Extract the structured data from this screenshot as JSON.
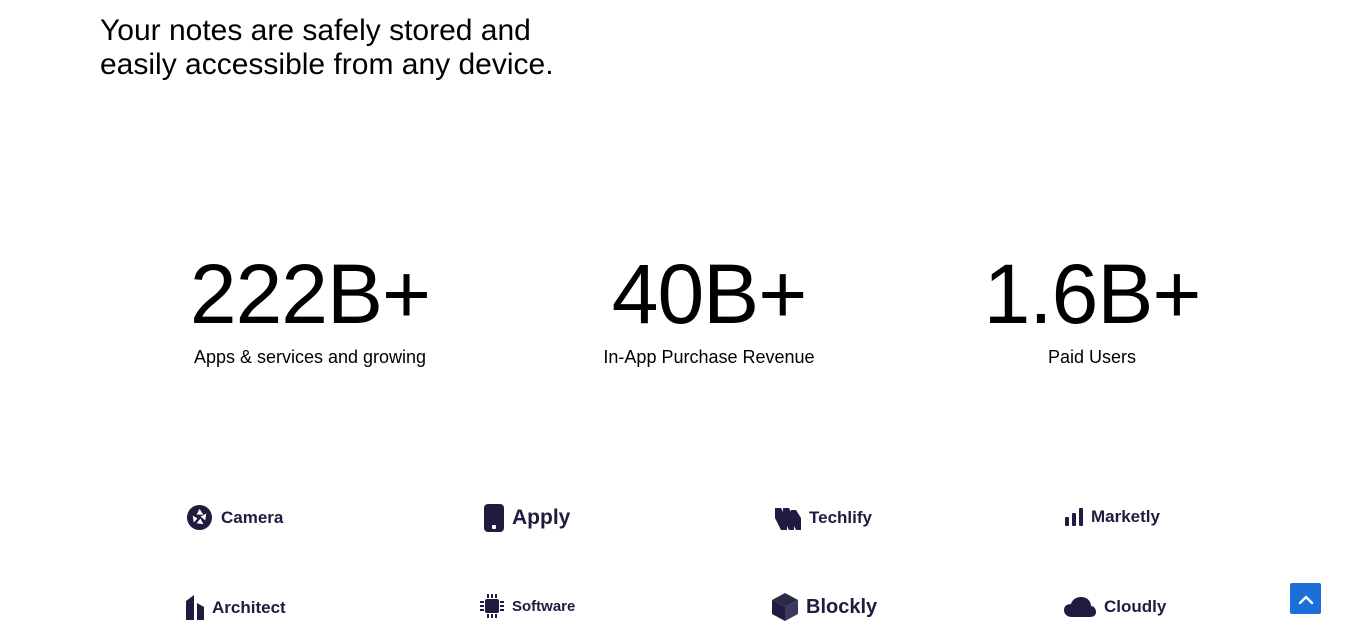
{
  "hero": {
    "line1": "Your notes are safely stored and",
    "line2": "easily accessible from any device."
  },
  "stats": [
    {
      "value": "222B+",
      "label": "Apps & services and growing"
    },
    {
      "value": "40B+",
      "label": "In-App Purchase Revenue"
    },
    {
      "value": "1.6B+",
      "label": "Paid Users"
    }
  ],
  "logos": [
    {
      "name": "Camera",
      "icon": "camera-aperture-icon"
    },
    {
      "name": "Apply",
      "icon": "phone-icon"
    },
    {
      "name": "Techlify",
      "icon": "techlify-stripes-icon"
    },
    {
      "name": "Marketly",
      "icon": "bar-chart-icon"
    },
    {
      "name": "Architect",
      "icon": "building-icon"
    },
    {
      "name": "Software",
      "icon": "chip-icon"
    },
    {
      "name": "Blockly",
      "icon": "cube-icon"
    },
    {
      "name": "Cloudly",
      "icon": "cloud-icon"
    }
  ],
  "colors": {
    "logo_text": "#1f1c3f",
    "scroll_top_button": "#1b6fd6"
  },
  "scroll_top": {
    "icon": "chevron-up-icon"
  }
}
